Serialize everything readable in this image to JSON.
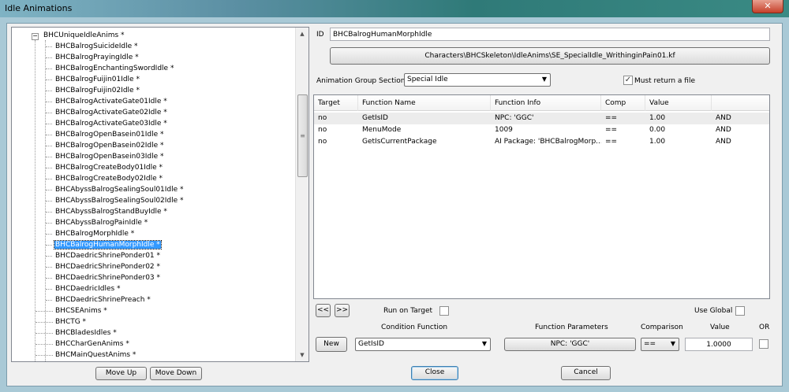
{
  "window": {
    "title": "Idle Animations",
    "close_glyph": "✕"
  },
  "tree": {
    "root": "BHCUniqueIdleAnims *",
    "items": [
      "BHCBalrogSuicideIdle *",
      "BHCBalrogPrayingIdle *",
      "BHCBalrogEnchantingSwordIdle *",
      "BHCBalrogFuijin01Idle *",
      "BHCBalrogFuijin02Idle *",
      "BHCBalrogActivateGate01Idle *",
      "BHCBalrogActivateGate02Idle *",
      "BHCBalrogActivateGate03Idle *",
      "BHCBalrogOpenBasein01Idle *",
      "BHCBalrogOpenBasein02Idle *",
      "BHCBalrogOpenBasein03Idle *",
      "BHCBalrogCreateBody01Idle *",
      "BHCBalrogCreateBody02Idle *",
      "BHCAbyssBalrogSealingSoul01Idle *",
      "BHCAbyssBalrogSealingSoul02Idle *",
      "BHCAbyssBalrogStandBuyIdle *",
      "BHCAbyssBalrogPainIdle *",
      "BHCBalrogMorphIdle *",
      "BHCBalrogHumanMorphIdle *",
      "BHCDaedricShrinePonder01 *",
      "BHCDaedricShrinePonder02 *",
      "BHCDaedricShrinePonder03 *",
      "BHCDaedricIdles *",
      "BHCDaedricShrinePreach *"
    ],
    "top_items": [
      "BHCSEAnims *",
      "BHCTG *",
      "BHCBladesIdles *",
      "BHCCharGenAnims *",
      "BHCMainQuestAnims *"
    ],
    "selected_index": 18,
    "expander_glyph": "−",
    "scroll_up": "▲",
    "scroll_down": "▼",
    "scroll_grip": "≡"
  },
  "buttons": {
    "move_up": "Move Up",
    "move_down": "Move Down",
    "prev": "<<",
    "next": ">>",
    "new": "New",
    "close": "Close",
    "cancel": "Cancel"
  },
  "form": {
    "id_label": "ID",
    "id_value": "BHCBalrogHumanMorphIdle",
    "anim_path": "Characters\\BHCSkeleton\\IdleAnims\\SE_SpecialIdle_WrithinginPain01.kf",
    "group_label": "Animation Group Section:",
    "group_value": "Special Idle",
    "must_return_label": "Must return a file",
    "must_return_checked": "✓"
  },
  "conditions": {
    "headers": [
      "Target",
      "Function Name",
      "Function Info",
      "Comp",
      "Value",
      ""
    ],
    "rows": [
      [
        "no",
        "GetIsID",
        "NPC: 'GGC'",
        "==",
        "1.00",
        "AND"
      ],
      [
        "no",
        "MenuMode",
        "1009",
        "==",
        "0.00",
        "AND"
      ],
      [
        "no",
        "GetIsCurrentPackage",
        "AI Package: 'BHCBalrogMorp...",
        "==",
        "1.00",
        "AND"
      ]
    ]
  },
  "editor": {
    "run_on_target_label": "Run on Target",
    "use_global_label": "Use Global",
    "condition_function_label": "Condition Function",
    "function_parameters_label": "Function Parameters",
    "comparison_label": "Comparison",
    "value_label": "Value",
    "or_label": "OR",
    "function_value": "GetIsID",
    "params_value": "NPC: 'GGC'",
    "comparison_value": "==",
    "value_value": "1.0000",
    "dropdown_glyph": "▼"
  }
}
